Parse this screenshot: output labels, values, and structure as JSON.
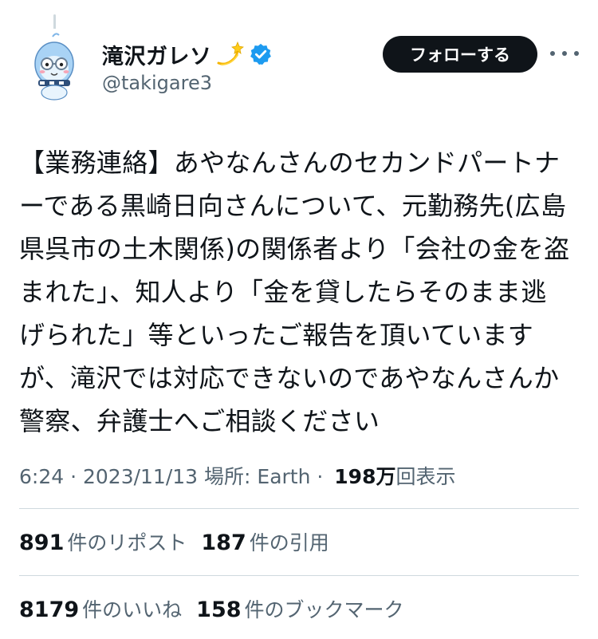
{
  "author": {
    "display_name": "滝沢ガレソ",
    "handle": "@takigare3",
    "name_emoji": "dizzy-icon",
    "verified_icon": "verified-badge-icon",
    "verified_color": "#1d9bf0"
  },
  "actions": {
    "follow_label": "フォローする",
    "more_icon": "more-horizontal-icon"
  },
  "tweet": {
    "lines": [
      "【業務連絡】あやなんさんのセカンドパートナ",
      "ーである黒崎日向さんについて、元勤務先(広島",
      "県呉市の土木関係)の関係者より「会社の金を盗",
      "まれた」、知人より「金を貸したらそのまま逃",
      "げられた」等といったご報告を頂いています",
      "が、滝沢では対応できないのであやなんさんか",
      "警察、弁護士へご相談ください"
    ]
  },
  "meta": {
    "time": "6:24",
    "sep1": " · ",
    "date": "2023/11/13",
    "location": " 場所: Earth",
    "sep2": " · ",
    "views_count": "198万",
    "views_label": "回表示"
  },
  "stats": {
    "reposts_count": "891",
    "reposts_label": "件のリポスト",
    "quotes_count": "187",
    "quotes_label": "件の引用",
    "likes_count": "8179",
    "likes_label": "件のいいね",
    "bookmarks_count": "158",
    "bookmarks_label": "件のブックマーク"
  },
  "colors": {
    "text_primary": "#0f1419",
    "text_secondary": "#536471",
    "divider": "#cfd9de",
    "follow_bg": "#0f1419"
  }
}
